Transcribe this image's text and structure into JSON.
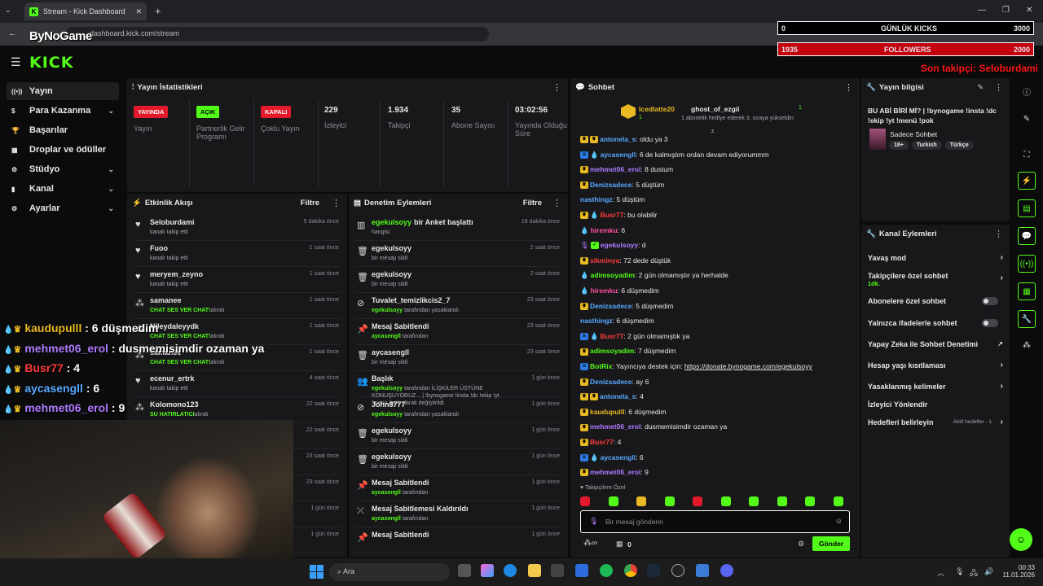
{
  "browser": {
    "tab_title": "Stream - Kick Dashboard",
    "url": "dashboard.kick.com/stream",
    "watermark": "ByNoGame"
  },
  "overlay_stats": {
    "daily_kicks_value": "0",
    "daily_kicks_label": "GÜNLÜK KICKS",
    "daily_kicks_goal": "3000",
    "followers_value": "1935",
    "followers_label": "FOLLOWERS",
    "followers_goal": "2000",
    "last_follower": "Son takipçi: Seloburdami"
  },
  "kick_logo": "KICK",
  "sidebar": [
    {
      "label": "Yayın",
      "icon": "broadcast-icon",
      "chevron": false,
      "active": true
    },
    {
      "label": "Para Kazanma",
      "icon": "dollar-icon",
      "chevron": true
    },
    {
      "label": "Başarılar",
      "icon": "trophy-icon",
      "chevron": false
    },
    {
      "label": "Droplar ve ödüller",
      "icon": "gift-icon",
      "chevron": false
    },
    {
      "label": "Stüdyo",
      "icon": "studio-icon",
      "chevron": true
    },
    {
      "label": "Kanal",
      "icon": "channel-icon",
      "chevron": true
    },
    {
      "label": "Ayarlar",
      "icon": "gear-icon",
      "chevron": true
    }
  ],
  "stream_stats": {
    "title": "Yayın İstatistikleri",
    "items": [
      {
        "badge": "YAYINDA",
        "label": "Yayın"
      },
      {
        "badge": "AÇIK",
        "label": "Partnerlik Gelir Programı"
      },
      {
        "badge": "KAPALI",
        "label": "Çoklu Yayın"
      },
      {
        "value": "229",
        "label": "İzleyici"
      },
      {
        "value": "1.934",
        "label": "Takipçi"
      },
      {
        "value": "35",
        "label": "Abone Sayısı"
      },
      {
        "value": "03:02:56",
        "label": "Yayında Olduğu Süre"
      }
    ]
  },
  "activity": {
    "title": "Etkinlik Akışı",
    "filter": "Filtre",
    "rows": [
      {
        "name": "Seloburdami",
        "sub": "kanalı takip etti",
        "time": "5 dakika önce",
        "icon": "heart"
      },
      {
        "name": "Fuoo",
        "sub": "kanalı takip etti",
        "time": "1 saat önce",
        "icon": "heart"
      },
      {
        "name": "meryem_zeyno",
        "sub": "kanalı takip etti",
        "time": "1 saat önce",
        "icon": "heart"
      },
      {
        "name": "samanee",
        "sub_green": "CHAT SES VER CHAT!",
        "sub": "alındı",
        "time": "1 saat önce",
        "icon": "dots"
      },
      {
        "name": "Nileydaleyydk",
        "sub_green": "CHAT SES VER CHAT!",
        "sub": "alındı",
        "time": "1 saat önce",
        "icon": "dots"
      },
      {
        "name": "samanee",
        "sub_green": "CHAT SES VER CHAT!",
        "sub": "alındı",
        "time": "1 saat önce",
        "icon": "dots"
      },
      {
        "name": "ecenur_ertrk",
        "sub": "kanalı takip etti",
        "time": "4 saat önce",
        "icon": "heart"
      },
      {
        "name": "Kolomono123",
        "sub_green": "SU HATIRLATICI",
        "sub": "alındı",
        "time": "22 saat önce",
        "icon": "dots"
      },
      {
        "name": "",
        "sub": "",
        "time": "22 saat önce",
        "icon": ""
      },
      {
        "name": "",
        "sub": "",
        "time": "23 saat önce",
        "icon": ""
      },
      {
        "name": "",
        "sub": "",
        "time": "23 saat önce",
        "icon": ""
      },
      {
        "name": "",
        "sub": "",
        "time": "1 gün önce",
        "icon": ""
      },
      {
        "name": "",
        "sub": "",
        "time": "1 gün önce",
        "icon": ""
      }
    ]
  },
  "moderation": {
    "title": "Denetim Eylemleri",
    "filter": "Filtre",
    "rows": [
      {
        "name": "egekulsoyy",
        "name_suffix": " bir Anket başlattı",
        "sub": "hangisi",
        "time": "18 dakika önce",
        "icon": "poll",
        "name_green": true
      },
      {
        "name": "egekulsoyy",
        "sub": "bir mesajı sildi",
        "time": "2 saat önce",
        "icon": "trash"
      },
      {
        "name": "egekulsoyy",
        "sub": "bir mesajı sildi",
        "time": "2 saat önce",
        "icon": "trash"
      },
      {
        "name": "Tuvalet_temizlikcis2_7",
        "sub_green": "egekulsoyy",
        "sub": " tarafından yasaklandı",
        "time": "23 saat önce",
        "icon": "ban"
      },
      {
        "name": "Mesaj Sabitlendi",
        "sub_green": "aycasengll",
        "sub": " tarafından",
        "time": "23 saat önce",
        "icon": "pin"
      },
      {
        "name": "aycasengll",
        "sub": "bir mesajı sildi",
        "time": "23 saat önce",
        "icon": "trash"
      },
      {
        "name": "Başlık",
        "sub_green": "egekulsoyy",
        "sub": " tarafından İLİŞKİLER ÜSTÜNE KONUŞUYORUZ... | !bynogame !insta !dc !ekip !yt !menü !pok olarak değiştirildi",
        "time": "1 gün önce",
        "icon": "user"
      },
      {
        "name": "John8777",
        "sub_green": "egekulsoyy",
        "sub": " tarafından yasaklandı",
        "time": "1 gün önce",
        "icon": "ban"
      },
      {
        "name": "egekulsoyy",
        "sub": "bir mesajı sildi",
        "time": "1 gün önce",
        "icon": "trash"
      },
      {
        "name": "egekulsoyy",
        "sub": "bir mesajı sildi",
        "time": "1 gün önce",
        "icon": "trash"
      },
      {
        "name": "Mesaj Sabitlendi",
        "sub_green": "aycasengll",
        "sub": " tarafından",
        "time": "1 gün önce",
        "icon": "pin"
      },
      {
        "name": "Mesaj Sabitlemesi Kaldırıldı",
        "sub_green": "aycasengll",
        "sub": " tarafından",
        "time": "1 gün önce",
        "icon": "unpin"
      },
      {
        "name": "Mesaj Sabitlendi",
        "sub": "",
        "time": "1 gün önce",
        "icon": "pin"
      }
    ]
  },
  "chat": {
    "title": "Sohbet",
    "gift_user": "Icedlatte20",
    "gift_count": "1",
    "gift_target": "ghost_of_ezgii",
    "gift_target_count": "1",
    "gift_text": "1 abonelik hediye ederek 3. sıraya yükseldin",
    "messages": [
      {
        "user": "antonela_s",
        "color": "#5aa9ff",
        "text": "oldu ya 3",
        "badges": [
          "y",
          "y"
        ]
      },
      {
        "user": "aycasengll",
        "color": "#5aa9ff",
        "text": "6 de kalmıştım ordan devam ediyorummm",
        "badges": [
          "b",
          "drop"
        ]
      },
      {
        "user": "mehmet06_erol",
        "color": "#b07cff",
        "text": "8 dustum",
        "badges": [
          "y"
        ]
      },
      {
        "user": "Denizsadece",
        "color": "#5aa9ff",
        "text": "5 düştüm",
        "badges": [
          "y"
        ]
      },
      {
        "user": "nasthingz",
        "color": "#5aa9ff",
        "text": "5 düştüm",
        "badges": []
      },
      {
        "user": "Busr77",
        "color": "#ff3b3b",
        "text": "bu olabilir",
        "badges": [
          "y",
          "drop"
        ]
      },
      {
        "user": "hiremku",
        "color": "#ff4fa0",
        "text": "6",
        "badges": [
          "drop"
        ]
      },
      {
        "user": "egekulsoyy",
        "color": "#b07cff",
        "text": "d",
        "badges": [
          "mic",
          "g"
        ]
      },
      {
        "user": "sikminya",
        "color": "#ff3b3b",
        "text": "72 dede düştük",
        "badges": [
          "y"
        ]
      },
      {
        "user": "adimsoyadim",
        "color": "#53fc18",
        "text": "2 gün olmamıştır ya herhalde",
        "badges": [
          "drop"
        ]
      },
      {
        "user": "hiremku",
        "color": "#ff4fa0",
        "text": "6 düşmedim",
        "badges": [
          "drop"
        ]
      },
      {
        "user": "Denizsadece",
        "color": "#5aa9ff",
        "text": "5 düşmedim",
        "badges": [
          "y"
        ]
      },
      {
        "user": "nasthingz",
        "color": "#5aa9ff",
        "text": "6 düşmedim",
        "badges": []
      },
      {
        "user": "Busr77",
        "color": "#ff3b3b",
        "text": "2 gün olmamıştık ya",
        "badges": [
          "b",
          "drop"
        ]
      },
      {
        "user": "adimsoyadim",
        "color": "#53fc18",
        "text": "7 düşmedim",
        "badges": [
          "y"
        ]
      },
      {
        "user": "BotRix",
        "color": "#53fc18",
        "text": "Yayıncıya destek için: ",
        "link": "https://donate.bynogame.com/egekulsoyy",
        "badges": [
          "b"
        ]
      },
      {
        "user": "Denizsadece",
        "color": "#5aa9ff",
        "text": "ay 6",
        "badges": [
          "y"
        ]
      },
      {
        "user": "antonela_s",
        "color": "#5aa9ff",
        "text": "4",
        "badges": [
          "y",
          "y"
        ]
      },
      {
        "user": "kaudupulll",
        "color": "#e8b923",
        "text": "6 düşmedim",
        "badges": [
          "y"
        ]
      },
      {
        "user": "mehmet06_erol",
        "color": "#b07cff",
        "text": "dusmemisimdir ozaman ya",
        "badges": [
          "y"
        ]
      },
      {
        "user": "Busr77",
        "color": "#ff3b3b",
        "text": "4",
        "badges": [
          "y"
        ]
      },
      {
        "user": "aycasengll",
        "color": "#5aa9ff",
        "text": "6",
        "badges": [
          "b",
          "drop"
        ]
      },
      {
        "user": "mehmet06_erol",
        "color": "#b07cff",
        "text": "9",
        "badges": [
          "y"
        ]
      }
    ],
    "followers_only": "Takipçilere Özel",
    "input_placeholder": "Bir mesaj gönderin",
    "send": "Gönder",
    "count": "0"
  },
  "stream_info": {
    "title": "Yayın bilgisi",
    "stream_title": "BU ABİ BİRİ Mİ? | !bynogame !insta !dc !ekip !yt !menü !pok",
    "category": "Sadece Sohbet",
    "tags": [
      "18+",
      "Turkish",
      "Türkçe"
    ]
  },
  "channel_actions": {
    "title": "Kanal Eylemleri",
    "items": [
      {
        "label": "Yavaş mod",
        "type": "arrow"
      },
      {
        "label": "Takipçilere özel sohbet",
        "sub": "1dk.",
        "type": "arrow"
      },
      {
        "label": "Abonelere özel sohbet",
        "type": "toggle"
      },
      {
        "label": "Yalnızca ifadelerle sohbet",
        "type": "toggle"
      },
      {
        "label": "Yapay Zeka ile Sohbet Denetimi",
        "type": "external"
      },
      {
        "label": "Hesap yaşı kısıtlaması",
        "type": "arrow"
      },
      {
        "label": "Yasaklanmış kelimeler",
        "type": "arrow"
      },
      {
        "label": "İzleyici Yönlendir",
        "type": "none"
      },
      {
        "label": "Hedefleri belirleyin",
        "extra": "Aktif hedefler - 1",
        "type": "arrow"
      }
    ]
  },
  "overlay_chat": [
    {
      "user": "kaudupulll",
      "color": "#e8b923",
      "text": " : 6 düşmedim"
    },
    {
      "user": "mehmet06_erol",
      "color": "#b07cff",
      "text": " : dusmemisimdir ozaman ya"
    },
    {
      "user": "Busr77",
      "color": "#ff3b3b",
      "text": " : 4"
    },
    {
      "user": "aycasengll",
      "color": "#5aa9ff",
      "text": " : 6"
    },
    {
      "user": "mehmet06_erol",
      "color": "#b07cff",
      "text": " : 9"
    }
  ],
  "taskbar": {
    "search": "Ara",
    "time": "00:33",
    "date": "11.01.2026"
  },
  "colors": {
    "kick_green": "#53fc18",
    "live_red": "#e3192c",
    "panel": "#18181b"
  }
}
